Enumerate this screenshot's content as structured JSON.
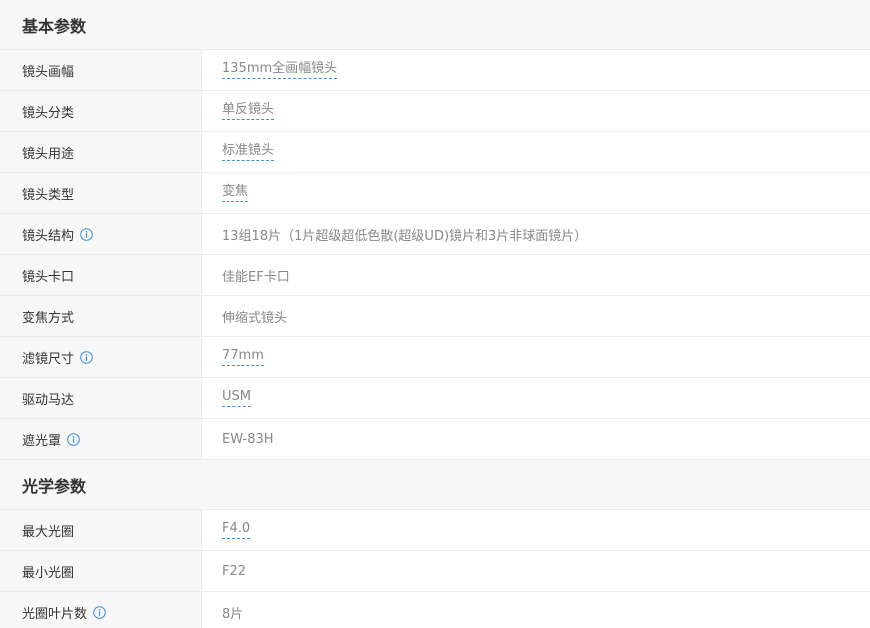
{
  "sections": [
    {
      "title": "基本参数",
      "rows": [
        {
          "label": "镜头画幅",
          "value": "135mm全画幅镜头",
          "link": true,
          "info": false
        },
        {
          "label": "镜头分类",
          "value": "单反镜头",
          "link": true,
          "info": false
        },
        {
          "label": "镜头用途",
          "value": "标准镜头",
          "link": true,
          "info": false
        },
        {
          "label": "镜头类型",
          "value": "变焦",
          "link": true,
          "info": false
        },
        {
          "label": "镜头结构",
          "value": "13组18片（1片超级超低色散(超级UD)镜片和3片非球面镜片）",
          "link": false,
          "info": true
        },
        {
          "label": "镜头卡口",
          "value": "佳能EF卡口",
          "link": false,
          "info": false
        },
        {
          "label": "变焦方式",
          "value": "伸缩式镜头",
          "link": false,
          "info": false
        },
        {
          "label": "滤镜尺寸",
          "value": "77mm",
          "link": true,
          "info": true
        },
        {
          "label": "驱动马达",
          "value": "USM",
          "link": true,
          "info": false
        },
        {
          "label": "遮光罩",
          "value": "EW-83H",
          "link": false,
          "info": true
        }
      ]
    },
    {
      "title": "光学参数",
      "rows": [
        {
          "label": "最大光圈",
          "value": "F4.0",
          "link": true,
          "info": false
        },
        {
          "label": "最小光圈",
          "value": "F22",
          "link": false,
          "info": false
        },
        {
          "label": "光圈叶片数",
          "value": "8片",
          "link": false,
          "info": true
        }
      ]
    }
  ],
  "colors": {
    "label_bg": "#f7f7f7",
    "border": "#ececec",
    "info_icon": "#3a8fd9",
    "dashed_underline": "#3a8fd9"
  },
  "icons": {
    "info": "info-circle-icon"
  }
}
